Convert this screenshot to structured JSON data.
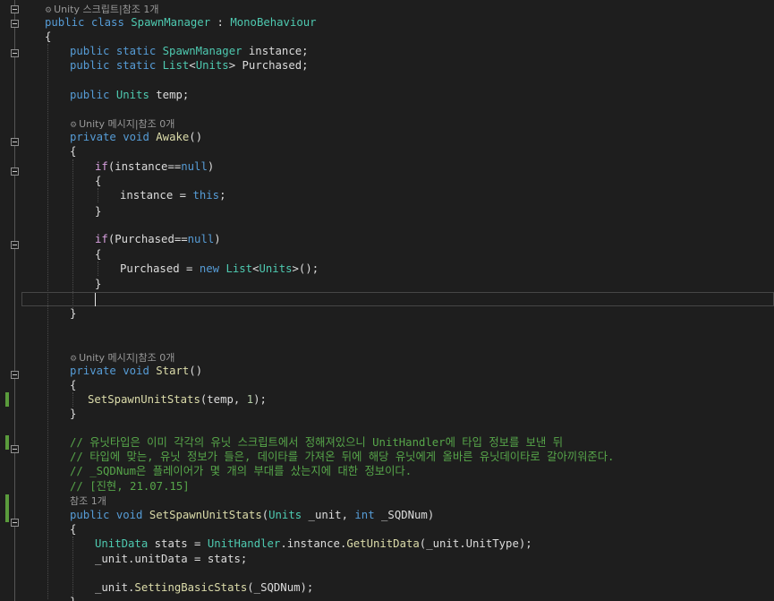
{
  "editor": {
    "colors": {
      "background": "#1e1e1e",
      "keyword": "#569cd6",
      "control": "#d8a0df",
      "type": "#4ec9b0",
      "method": "#dcdcaa",
      "comment": "#57a64a",
      "number": "#b5cea8",
      "text": "#dcdcdc",
      "codelens": "#999999",
      "change_bar": "#5a9b3c"
    },
    "lines": [
      {
        "kind": "lens",
        "text": "Unity 스크립트|참조 1개"
      },
      {
        "kind": "code",
        "tokens": [
          {
            "t": "public",
            "c": "kw"
          },
          {
            "t": " "
          },
          {
            "t": "class",
            "c": "kw"
          },
          {
            "t": " "
          },
          {
            "t": "SpawnManager",
            "c": "ty"
          },
          {
            "t": " : "
          },
          {
            "t": "MonoBehaviour",
            "c": "ty"
          }
        ]
      },
      {
        "kind": "code",
        "tokens": [
          {
            "t": "{"
          }
        ]
      },
      {
        "kind": "blank"
      },
      {
        "kind": "code",
        "tokens": [
          {
            "t": "public",
            "c": "kw"
          },
          {
            "t": " "
          },
          {
            "t": "static",
            "c": "kw"
          },
          {
            "t": " "
          },
          {
            "t": "SpawnManager",
            "c": "ty"
          },
          {
            "t": " instance;"
          }
        ]
      },
      {
        "kind": "code",
        "tokens": [
          {
            "t": "public",
            "c": "kw"
          },
          {
            "t": " "
          },
          {
            "t": "static",
            "c": "kw"
          },
          {
            "t": " "
          },
          {
            "t": "List",
            "c": "ty"
          },
          {
            "t": "<"
          },
          {
            "t": "Units",
            "c": "ty"
          },
          {
            "t": "> Purchased;"
          }
        ]
      },
      {
        "kind": "blank"
      },
      {
        "kind": "code",
        "tokens": [
          {
            "t": "public",
            "c": "kw"
          },
          {
            "t": " "
          },
          {
            "t": "Units",
            "c": "ty"
          },
          {
            "t": " temp;"
          }
        ]
      },
      {
        "kind": "blank"
      },
      {
        "kind": "lens",
        "text": "Unity 메시지|참조 0개"
      },
      {
        "kind": "code",
        "tokens": [
          {
            "t": "private",
            "c": "kw"
          },
          {
            "t": " "
          },
          {
            "t": "void",
            "c": "kw"
          },
          {
            "t": " "
          },
          {
            "t": "Awake",
            "c": "fn"
          },
          {
            "t": "()"
          }
        ]
      },
      {
        "kind": "code",
        "tokens": [
          {
            "t": "{"
          }
        ]
      },
      {
        "kind": "code",
        "tokens": [
          {
            "t": "if",
            "c": "ctl"
          },
          {
            "t": "(instance=="
          },
          {
            "t": "null",
            "c": "kw"
          },
          {
            "t": ")"
          }
        ]
      },
      {
        "kind": "code",
        "tokens": [
          {
            "t": "{"
          }
        ]
      },
      {
        "kind": "code",
        "tokens": [
          {
            "t": "instance = "
          },
          {
            "t": "this",
            "c": "kw"
          },
          {
            "t": ";"
          }
        ]
      },
      {
        "kind": "code",
        "tokens": [
          {
            "t": "}"
          }
        ]
      },
      {
        "kind": "blank"
      },
      {
        "kind": "code",
        "tokens": [
          {
            "t": "if",
            "c": "ctl"
          },
          {
            "t": "(Purchased=="
          },
          {
            "t": "null",
            "c": "kw"
          },
          {
            "t": ")"
          }
        ]
      },
      {
        "kind": "code",
        "tokens": [
          {
            "t": "{"
          }
        ]
      },
      {
        "kind": "code",
        "tokens": [
          {
            "t": "Purchased = "
          },
          {
            "t": "new",
            "c": "kw"
          },
          {
            "t": " "
          },
          {
            "t": "List",
            "c": "ty"
          },
          {
            "t": "<"
          },
          {
            "t": "Units",
            "c": "ty"
          },
          {
            "t": ">();"
          }
        ]
      },
      {
        "kind": "code",
        "tokens": [
          {
            "t": "}"
          }
        ]
      },
      {
        "kind": "blank"
      },
      {
        "kind": "code",
        "tokens": [
          {
            "t": "}"
          }
        ]
      },
      {
        "kind": "blank"
      },
      {
        "kind": "blank"
      },
      {
        "kind": "lens",
        "text": "Unity 메시지|참조 0개"
      },
      {
        "kind": "code",
        "tokens": [
          {
            "t": "private",
            "c": "kw"
          },
          {
            "t": " "
          },
          {
            "t": "void",
            "c": "kw"
          },
          {
            "t": " "
          },
          {
            "t": "Start",
            "c": "fn"
          },
          {
            "t": "()"
          }
        ]
      },
      {
        "kind": "code",
        "tokens": [
          {
            "t": "{"
          }
        ]
      },
      {
        "kind": "code",
        "tokens": [
          {
            "t": "SetSpawnUnitStats",
            "c": "fn"
          },
          {
            "t": "(temp, "
          },
          {
            "t": "1",
            "c": "nm"
          },
          {
            "t": ");"
          }
        ]
      },
      {
        "kind": "code",
        "tokens": [
          {
            "t": "}"
          }
        ]
      },
      {
        "kind": "blank"
      },
      {
        "kind": "code",
        "tokens": [
          {
            "t": "// 유닛타입은 이미 각각의 유닛 스크립트에서 정해져있으니 UnitHandler에 타입 정보를 보낸 뒤",
            "c": "cm"
          }
        ]
      },
      {
        "kind": "code",
        "tokens": [
          {
            "t": "// 타입에 맞는, 유닛 정보가 들은, 데이타를 가져온 뒤에 해당 유닛에게 올바른 유닛데이타로 갈아끼워준다.",
            "c": "cm"
          }
        ]
      },
      {
        "kind": "code",
        "tokens": [
          {
            "t": "// _SQDNum은 플레이어가 몇 개의 부대를 샀는지에 대한 정보이다.",
            "c": "cm"
          }
        ]
      },
      {
        "kind": "code",
        "tokens": [
          {
            "t": "// [진현, 21.07.15]",
            "c": "cm"
          }
        ]
      },
      {
        "kind": "lens",
        "text": "참조 1개"
      },
      {
        "kind": "code",
        "tokens": [
          {
            "t": "public",
            "c": "kw"
          },
          {
            "t": " "
          },
          {
            "t": "void",
            "c": "kw"
          },
          {
            "t": " "
          },
          {
            "t": "SetSpawnUnitStats",
            "c": "fn"
          },
          {
            "t": "("
          },
          {
            "t": "Units",
            "c": "ty"
          },
          {
            "t": " _unit, "
          },
          {
            "t": "int",
            "c": "kw"
          },
          {
            "t": " _SQDNum)"
          }
        ]
      },
      {
        "kind": "code",
        "tokens": [
          {
            "t": "{"
          }
        ]
      },
      {
        "kind": "code",
        "tokens": [
          {
            "t": "UnitData",
            "c": "ty"
          },
          {
            "t": " stats = "
          },
          {
            "t": "UnitHandler",
            "c": "ty"
          },
          {
            "t": ".instance."
          },
          {
            "t": "GetUnitData",
            "c": "fn"
          },
          {
            "t": "(_unit.UnitType);"
          }
        ]
      },
      {
        "kind": "code",
        "tokens": [
          {
            "t": "_unit.unitData = stats;"
          }
        ]
      },
      {
        "kind": "blank"
      },
      {
        "kind": "code",
        "tokens": [
          {
            "t": "_unit."
          },
          {
            "t": "SettingBasicStats",
            "c": "fn"
          },
          {
            "t": "(_SQDNum);"
          }
        ]
      },
      {
        "kind": "code",
        "tokens": [
          {
            "t": "}"
          }
        ]
      }
    ]
  }
}
